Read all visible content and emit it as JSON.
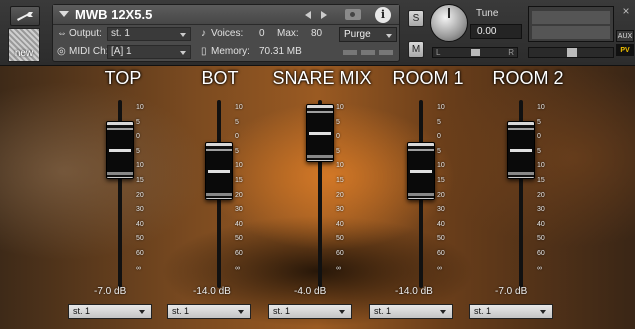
{
  "header": {
    "new_label": "new",
    "instrument_name": "MWB 12X5.5",
    "output_label": "Output:",
    "output_value": "st. 1",
    "voices_label": "Voices:",
    "voices_value": "0",
    "max_label": "Max:",
    "max_value": "80",
    "purge_label": "Purge",
    "midi_label": "MIDI Ch:",
    "midi_value": "[A]  1",
    "memory_label": "Memory:",
    "memory_value": "70.31 MB",
    "solo_label": "S",
    "mute_label": "M",
    "tune_label": "Tune",
    "tune_value": "0.00",
    "pan_left": "L",
    "pan_right": "R",
    "aux_label": "AUX",
    "pv_label": "PV",
    "info_label": "i",
    "close_label": "×"
  },
  "scale_ticks": [
    "10",
    "5",
    "0",
    "5",
    "10",
    "15",
    "20",
    "30",
    "40",
    "50",
    "60",
    "∞"
  ],
  "channels": [
    {
      "name": "TOP",
      "db": "-7.0 dB",
      "level": 0.14,
      "output": "st. 1"
    },
    {
      "name": "BOT",
      "db": "-14.0 dB",
      "level": 0.32,
      "output": "st. 1"
    },
    {
      "name": "SNARE MIX",
      "db": "-4.0 dB",
      "level": 0.0,
      "output": "st. 1"
    },
    {
      "name": "ROOM 1",
      "db": "-14.0 dB",
      "level": 0.32,
      "output": "st. 1"
    },
    {
      "name": "ROOM 2",
      "db": "-7.0 dB",
      "level": 0.14,
      "output": "st. 1"
    }
  ],
  "colors": {
    "accent": "#f0c000",
    "panel_bg": "#3a3a3a"
  }
}
